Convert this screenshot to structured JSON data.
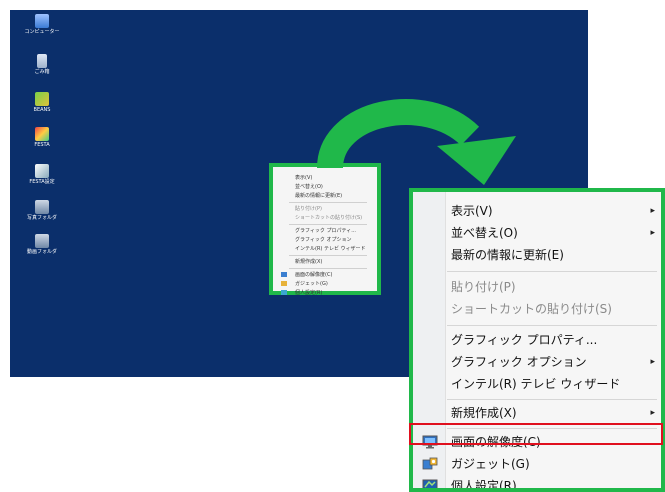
{
  "desktop": {
    "icons": [
      {
        "label": "コンピューター",
        "icon": "computer-icon"
      },
      {
        "label": "ごみ箱",
        "icon": "recycle-bin-icon"
      },
      {
        "label": "BEANS",
        "icon": "beans-app-icon"
      },
      {
        "label": "FESTA",
        "icon": "festa-app-icon"
      },
      {
        "label": "FESTA設定",
        "icon": "festa-settings-icon"
      },
      {
        "label": "写真フォルダ",
        "icon": "photo-folder-icon"
      },
      {
        "label": "動画フォルダ",
        "icon": "video-folder-icon"
      }
    ],
    "background": "#0b2f6b"
  },
  "small_menu": {
    "items": [
      {
        "label": "表示(V)"
      },
      {
        "label": "並べ替え(O)"
      },
      {
        "label": "最新の情報に更新(E)"
      },
      {
        "label": "貼り付け(P)"
      },
      {
        "label": "ショートカットの貼り付け(S)"
      },
      {
        "label": "グラフィック プロパティ..."
      },
      {
        "label": "グラフィック オプション"
      },
      {
        "label": "インテル(R) テレビ ウィザード"
      },
      {
        "label": "新規作成(X)"
      },
      {
        "label": "画面の解像度(C)"
      },
      {
        "label": "ガジェット(G)"
      },
      {
        "label": "個人設定(R)"
      }
    ]
  },
  "big_menu": {
    "items": [
      {
        "label": "表示(V)",
        "submenu": true,
        "disabled": false
      },
      {
        "label": "並べ替え(O)",
        "submenu": true,
        "disabled": false
      },
      {
        "label": "最新の情報に更新(E)",
        "submenu": false,
        "disabled": false
      },
      {
        "label": "貼り付け(P)",
        "submenu": false,
        "disabled": true
      },
      {
        "label": "ショートカットの貼り付け(S)",
        "submenu": false,
        "disabled": true
      },
      {
        "label": "グラフィック プロパティ...",
        "submenu": false,
        "disabled": false
      },
      {
        "label": "グラフィック オプション",
        "submenu": true,
        "disabled": false
      },
      {
        "label": "インテル(R) テレビ ウィザード",
        "submenu": false,
        "disabled": false
      },
      {
        "label": "新規作成(X)",
        "submenu": true,
        "disabled": false
      },
      {
        "label": "画面の解像度(C)",
        "submenu": false,
        "disabled": false,
        "icon": "display-icon",
        "highlighted": true
      },
      {
        "label": "ガジェット(G)",
        "submenu": false,
        "disabled": false,
        "icon": "gadget-icon"
      },
      {
        "label": "個人設定(R)",
        "submenu": false,
        "disabled": false,
        "icon": "personalize-icon"
      }
    ],
    "submenu_glyph": "▸"
  },
  "colors": {
    "frame_green": "#20b84a",
    "highlight_red": "#e0101e"
  }
}
